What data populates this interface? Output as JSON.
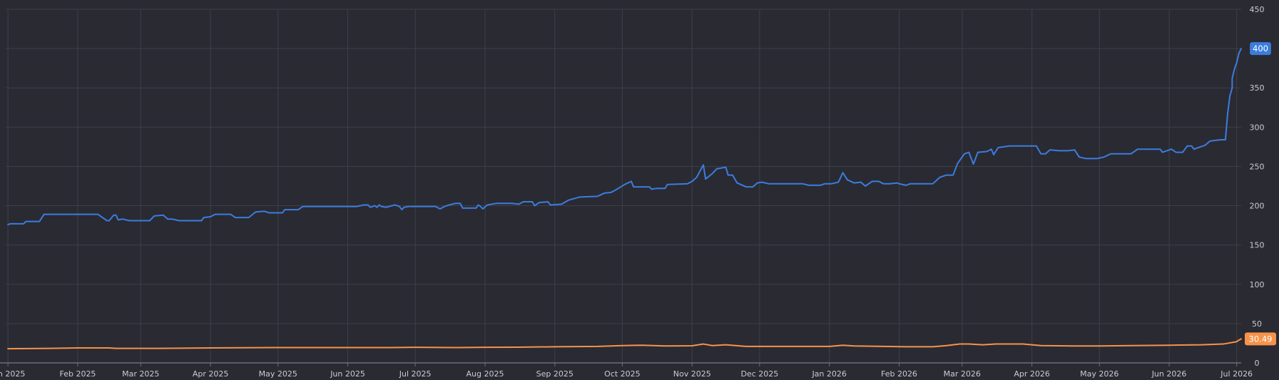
{
  "chart_data": {
    "type": "line",
    "title": "",
    "xlabel": "",
    "ylabel": "",
    "ylim": [
      0,
      450
    ],
    "y_ticks": [
      0,
      50,
      100,
      150,
      200,
      250,
      300,
      350,
      400,
      450
    ],
    "x_domain": [
      "2024-12-31",
      "2026-07-03"
    ],
    "x_ticks": [
      {
        "date": "2025-01-01",
        "label": "Jan 2025"
      },
      {
        "date": "2025-02-01",
        "label": "Feb 2025"
      },
      {
        "date": "2025-03-01",
        "label": "Mar 2025"
      },
      {
        "date": "2025-04-01",
        "label": "Apr 2025"
      },
      {
        "date": "2025-05-01",
        "label": "May 2025"
      },
      {
        "date": "2025-06-01",
        "label": "Jun 2025"
      },
      {
        "date": "2025-07-01",
        "label": "Jul 2025"
      },
      {
        "date": "2025-08-01",
        "label": "Aug 2025"
      },
      {
        "date": "2025-09-01",
        "label": "Sep 2025"
      },
      {
        "date": "2025-10-01",
        "label": "Oct 2025"
      },
      {
        "date": "2025-11-01",
        "label": "Nov 2025"
      },
      {
        "date": "2025-12-01",
        "label": "Dec 2025"
      },
      {
        "date": "2026-01-01",
        "label": "Jan 2026"
      },
      {
        "date": "2026-02-01",
        "label": "Feb 2026"
      },
      {
        "date": "2026-03-01",
        "label": "Mar 2026"
      },
      {
        "date": "2026-04-01",
        "label": "Apr 2026"
      },
      {
        "date": "2026-05-01",
        "label": "May 2026"
      },
      {
        "date": "2026-06-01",
        "label": "Jun 2026"
      },
      {
        "date": "2026-07-01",
        "label": "Jul 2026"
      }
    ],
    "grid": true,
    "y_axis_position": "right",
    "colors": {
      "background": "#2a2a33",
      "grid": "#3d3f49",
      "axis": "#6b6e78"
    },
    "series": [
      {
        "color": "#3b7ddd",
        "last_value_label": "400",
        "points": [
          [
            "2025-01-01",
            176
          ],
          [
            "2025-01-02",
            177
          ],
          [
            "2025-01-08",
            177
          ],
          [
            "2025-01-09",
            180
          ],
          [
            "2025-01-15",
            180
          ],
          [
            "2025-01-17",
            189
          ],
          [
            "2025-01-31",
            189
          ],
          [
            "2025-02-10",
            189
          ],
          [
            "2025-02-14",
            181
          ],
          [
            "2025-02-15",
            181
          ],
          [
            "2025-02-17",
            188
          ],
          [
            "2025-02-18",
            188
          ],
          [
            "2025-02-19",
            182
          ],
          [
            "2025-02-21",
            183
          ],
          [
            "2025-02-24",
            181
          ],
          [
            "2025-03-05",
            181
          ],
          [
            "2025-03-07",
            187
          ],
          [
            "2025-03-11",
            188
          ],
          [
            "2025-03-13",
            183
          ],
          [
            "2025-03-15",
            183
          ],
          [
            "2025-03-18",
            181
          ],
          [
            "2025-03-28",
            181
          ],
          [
            "2025-03-29",
            185
          ],
          [
            "2025-04-01",
            186
          ],
          [
            "2025-04-03",
            189
          ],
          [
            "2025-04-10",
            189
          ],
          [
            "2025-04-12",
            185
          ],
          [
            "2025-04-18",
            185
          ],
          [
            "2025-04-21",
            192
          ],
          [
            "2025-04-25",
            193
          ],
          [
            "2025-04-27",
            191
          ],
          [
            "2025-05-03",
            191
          ],
          [
            "2025-05-04",
            195
          ],
          [
            "2025-05-10",
            195
          ],
          [
            "2025-05-12",
            199
          ],
          [
            "2025-05-20",
            199
          ],
          [
            "2025-06-01",
            199
          ],
          [
            "2025-06-05",
            199
          ],
          [
            "2025-06-08",
            201
          ],
          [
            "2025-06-10",
            201
          ],
          [
            "2025-06-11",
            198
          ],
          [
            "2025-06-13",
            200
          ],
          [
            "2025-06-14",
            198
          ],
          [
            "2025-06-15",
            201
          ],
          [
            "2025-06-16",
            199
          ],
          [
            "2025-06-18",
            198
          ],
          [
            "2025-06-22",
            201
          ],
          [
            "2025-06-24",
            199
          ],
          [
            "2025-06-25",
            195
          ],
          [
            "2025-06-26",
            198
          ],
          [
            "2025-06-28",
            199
          ],
          [
            "2025-07-10",
            199
          ],
          [
            "2025-07-12",
            196
          ],
          [
            "2025-07-14",
            199
          ],
          [
            "2025-07-16",
            201
          ],
          [
            "2025-07-19",
            203
          ],
          [
            "2025-07-21",
            203
          ],
          [
            "2025-07-22",
            197
          ],
          [
            "2025-07-28",
            197
          ],
          [
            "2025-07-29",
            201
          ],
          [
            "2025-07-30",
            199
          ],
          [
            "2025-07-31",
            196
          ],
          [
            "2025-08-02",
            201
          ],
          [
            "2025-08-06",
            203
          ],
          [
            "2025-08-13",
            203
          ],
          [
            "2025-08-16",
            202
          ],
          [
            "2025-08-18",
            205
          ],
          [
            "2025-08-22",
            205
          ],
          [
            "2025-08-23",
            200
          ],
          [
            "2025-08-25",
            204
          ],
          [
            "2025-08-29",
            205
          ],
          [
            "2025-08-30",
            201
          ],
          [
            "2025-09-04",
            202
          ],
          [
            "2025-09-07",
            207
          ],
          [
            "2025-09-12",
            211
          ],
          [
            "2025-09-20",
            212
          ],
          [
            "2025-09-23",
            216
          ],
          [
            "2025-09-26",
            217
          ],
          [
            "2025-09-28",
            220
          ],
          [
            "2025-10-02",
            227
          ],
          [
            "2025-10-05",
            231
          ],
          [
            "2025-10-06",
            224
          ],
          [
            "2025-10-13",
            224
          ],
          [
            "2025-10-14",
            221
          ],
          [
            "2025-10-16",
            222
          ],
          [
            "2025-10-20",
            222
          ],
          [
            "2025-10-21",
            227
          ],
          [
            "2025-10-30",
            228
          ],
          [
            "2025-11-01",
            231
          ],
          [
            "2025-11-03",
            236
          ],
          [
            "2025-11-06",
            252
          ],
          [
            "2025-11-07",
            234
          ],
          [
            "2025-11-10",
            241
          ],
          [
            "2025-11-12",
            247
          ],
          [
            "2025-11-16",
            249
          ],
          [
            "2025-11-17",
            239
          ],
          [
            "2025-11-19",
            239
          ],
          [
            "2025-11-21",
            229
          ],
          [
            "2025-11-25",
            224
          ],
          [
            "2025-11-28",
            224
          ],
          [
            "2025-11-30",
            229
          ],
          [
            "2025-12-02",
            230
          ],
          [
            "2025-12-05",
            228
          ],
          [
            "2025-12-20",
            228
          ],
          [
            "2025-12-23",
            226
          ],
          [
            "2025-12-28",
            226
          ],
          [
            "2025-12-30",
            228
          ],
          [
            "2026-01-02",
            228
          ],
          [
            "2026-01-05",
            230
          ],
          [
            "2026-01-07",
            242
          ],
          [
            "2026-01-09",
            233
          ],
          [
            "2026-01-12",
            229
          ],
          [
            "2026-01-15",
            230
          ],
          [
            "2026-01-17",
            225
          ],
          [
            "2026-01-20",
            231
          ],
          [
            "2026-01-23",
            231
          ],
          [
            "2026-01-25",
            228
          ],
          [
            "2026-01-28",
            228
          ],
          [
            "2026-01-31",
            229
          ],
          [
            "2026-02-01",
            228
          ],
          [
            "2026-02-04",
            226
          ],
          [
            "2026-02-06",
            228
          ],
          [
            "2026-02-16",
            228
          ],
          [
            "2026-02-19",
            236
          ],
          [
            "2026-02-22",
            239
          ],
          [
            "2026-02-25",
            239
          ],
          [
            "2026-02-27",
            254
          ],
          [
            "2026-03-02",
            266
          ],
          [
            "2026-03-04",
            268
          ],
          [
            "2026-03-06",
            253
          ],
          [
            "2026-03-08",
            268
          ],
          [
            "2026-03-12",
            269
          ],
          [
            "2026-03-14",
            272
          ],
          [
            "2026-03-15",
            265
          ],
          [
            "2026-03-17",
            274
          ],
          [
            "2026-03-22",
            276
          ],
          [
            "2026-03-28",
            276
          ],
          [
            "2026-03-30",
            276
          ],
          [
            "2026-04-03",
            276
          ],
          [
            "2026-04-05",
            266
          ],
          [
            "2026-04-07",
            266
          ],
          [
            "2026-04-09",
            271
          ],
          [
            "2026-04-13",
            270
          ],
          [
            "2026-04-17",
            270
          ],
          [
            "2026-04-20",
            271
          ],
          [
            "2026-04-22",
            262
          ],
          [
            "2026-04-25",
            260
          ],
          [
            "2026-04-30",
            260
          ],
          [
            "2026-05-03",
            262
          ],
          [
            "2026-05-06",
            266
          ],
          [
            "2026-05-12",
            266
          ],
          [
            "2026-05-15",
            266
          ],
          [
            "2026-05-18",
            272
          ],
          [
            "2026-05-22",
            272
          ],
          [
            "2026-05-25",
            272
          ],
          [
            "2026-05-28",
            272
          ],
          [
            "2026-05-29",
            268
          ],
          [
            "2026-05-31",
            270
          ],
          [
            "2026-06-02",
            272
          ],
          [
            "2026-06-04",
            268
          ],
          [
            "2026-06-07",
            268
          ],
          [
            "2026-06-09",
            276
          ],
          [
            "2026-06-11",
            276
          ],
          [
            "2026-06-12",
            272
          ],
          [
            "2026-06-14",
            274
          ],
          [
            "2026-06-17",
            277
          ],
          [
            "2026-06-19",
            282
          ],
          [
            "2026-06-21",
            283
          ],
          [
            "2026-06-24",
            284
          ],
          [
            "2026-06-26",
            284
          ],
          [
            "2026-06-27",
            318
          ],
          [
            "2026-06-28",
            340
          ],
          [
            "2026-06-29",
            350
          ],
          [
            "2026-06-29",
            362
          ],
          [
            "2026-06-30",
            374
          ],
          [
            "2026-07-01",
            382
          ],
          [
            "2026-07-02",
            394
          ],
          [
            "2026-07-03",
            400
          ]
        ]
      },
      {
        "color": "#f6934a",
        "last_value_label": "30.49",
        "points": [
          [
            "2025-01-01",
            18
          ],
          [
            "2025-01-20",
            18.5
          ],
          [
            "2025-02-01",
            19
          ],
          [
            "2025-02-15",
            19
          ],
          [
            "2025-02-18",
            18.5
          ],
          [
            "2025-03-10",
            18.5
          ],
          [
            "2025-04-01",
            19
          ],
          [
            "2025-05-01",
            19.5
          ],
          [
            "2025-06-01",
            19.5
          ],
          [
            "2025-06-20",
            19.5
          ],
          [
            "2025-07-01",
            19.8
          ],
          [
            "2025-07-20",
            19.5
          ],
          [
            "2025-08-01",
            19.8
          ],
          [
            "2025-08-15",
            20
          ],
          [
            "2025-09-01",
            20.5
          ],
          [
            "2025-09-20",
            21
          ],
          [
            "2025-10-01",
            22
          ],
          [
            "2025-10-10",
            22.5
          ],
          [
            "2025-10-20",
            21.5
          ],
          [
            "2025-11-01",
            21.8
          ],
          [
            "2025-11-06",
            24
          ],
          [
            "2025-11-10",
            22
          ],
          [
            "2025-11-16",
            23
          ],
          [
            "2025-11-25",
            21
          ],
          [
            "2025-12-01",
            21
          ],
          [
            "2025-12-20",
            21
          ],
          [
            "2026-01-01",
            21
          ],
          [
            "2026-01-07",
            22.5
          ],
          [
            "2026-01-12",
            21.5
          ],
          [
            "2026-01-25",
            21
          ],
          [
            "2026-02-05",
            20.5
          ],
          [
            "2026-02-16",
            20.5
          ],
          [
            "2026-02-22",
            22
          ],
          [
            "2026-02-28",
            24
          ],
          [
            "2026-03-04",
            24
          ],
          [
            "2026-03-10",
            23
          ],
          [
            "2026-03-16",
            24
          ],
          [
            "2026-03-28",
            24
          ],
          [
            "2026-04-05",
            22
          ],
          [
            "2026-04-20",
            21.5
          ],
          [
            "2026-05-01",
            21.5
          ],
          [
            "2026-05-15",
            22
          ],
          [
            "2026-06-01",
            22.5
          ],
          [
            "2026-06-15",
            23
          ],
          [
            "2026-06-25",
            24
          ],
          [
            "2026-07-01",
            27
          ],
          [
            "2026-07-02",
            29
          ],
          [
            "2026-07-03",
            30.49
          ]
        ]
      }
    ]
  }
}
